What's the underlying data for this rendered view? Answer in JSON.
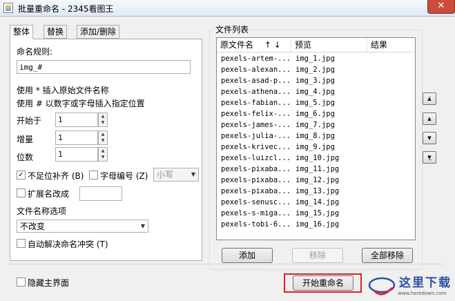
{
  "window": {
    "title": "批量重命名 - 2345看图王",
    "close_symbol": "✕"
  },
  "tabs": [
    {
      "label": "整体"
    },
    {
      "label": "替换"
    },
    {
      "label": "添加/删除"
    }
  ],
  "rename": {
    "rule_label": "命名规则:",
    "rule_value": "img_#",
    "hint1": "使用 * 插入原始文件名称",
    "hint2": "使用 # 以数字或字母插入指定位置",
    "start_label": "开始于",
    "start_value": "1",
    "step_label": "增量",
    "step_value": "1",
    "digits_label": "位数",
    "digits_value": "1",
    "pad_label": "不足位补齐 (B)",
    "pad_checked": true,
    "alpha_label": "字母编号 (Z)",
    "alpha_checked": false,
    "case_value": "小写",
    "ext_label": "扩展名改成",
    "ext_checked": false,
    "ext_value": "",
    "name_option_label": "文件名称选项",
    "name_option_value": "不改变",
    "conflict_label": "自动解决命名冲突 (T)",
    "conflict_checked": false
  },
  "file_list": {
    "group_title": "文件列表",
    "col_original": "原文件名",
    "sort_arrows": "↑ ↓",
    "col_preview": "预览",
    "col_result": "结果",
    "rows": [
      {
        "original": "pexels-artem-...",
        "preview": "img_1.jpg"
      },
      {
        "original": "pexels-alexan...",
        "preview": "img_2.jpg"
      },
      {
        "original": "pexels-asad-p...",
        "preview": "img_3.jpg"
      },
      {
        "original": "pexels-athena...",
        "preview": "img_4.jpg"
      },
      {
        "original": "pexels-fabian...",
        "preview": "img_5.jpg"
      },
      {
        "original": "pexels-felix-...",
        "preview": "img_6.jpg"
      },
      {
        "original": "pexels-james-...",
        "preview": "img_7.jpg"
      },
      {
        "original": "pexels-julia-...",
        "preview": "img_8.jpg"
      },
      {
        "original": "pexels-krivec...",
        "preview": "img_9.jpg"
      },
      {
        "original": "pexels-luizcl...",
        "preview": "img_10.jpg"
      },
      {
        "original": "pexels-pixaba...",
        "preview": "img_11.jpg"
      },
      {
        "original": "pexels-pixaba...",
        "preview": "img_12.jpg"
      },
      {
        "original": "pexels-pixaba...",
        "preview": "img_13.jpg"
      },
      {
        "original": "pexels-senusc...",
        "preview": "img_14.jpg"
      },
      {
        "original": "pexels-s-miga...",
        "preview": "img_15.jpg"
      },
      {
        "original": "pexels-tobi-6...",
        "preview": "img_16.jpg"
      }
    ]
  },
  "buttons": {
    "add": "添加",
    "remove": "移除",
    "remove_all": "全部移除",
    "start_rename": "开始重命名"
  },
  "hide_main": {
    "label": "隐藏主界面",
    "checked": false
  },
  "watermark": {
    "text": "这里下载",
    "url": "www.heredown.com"
  }
}
